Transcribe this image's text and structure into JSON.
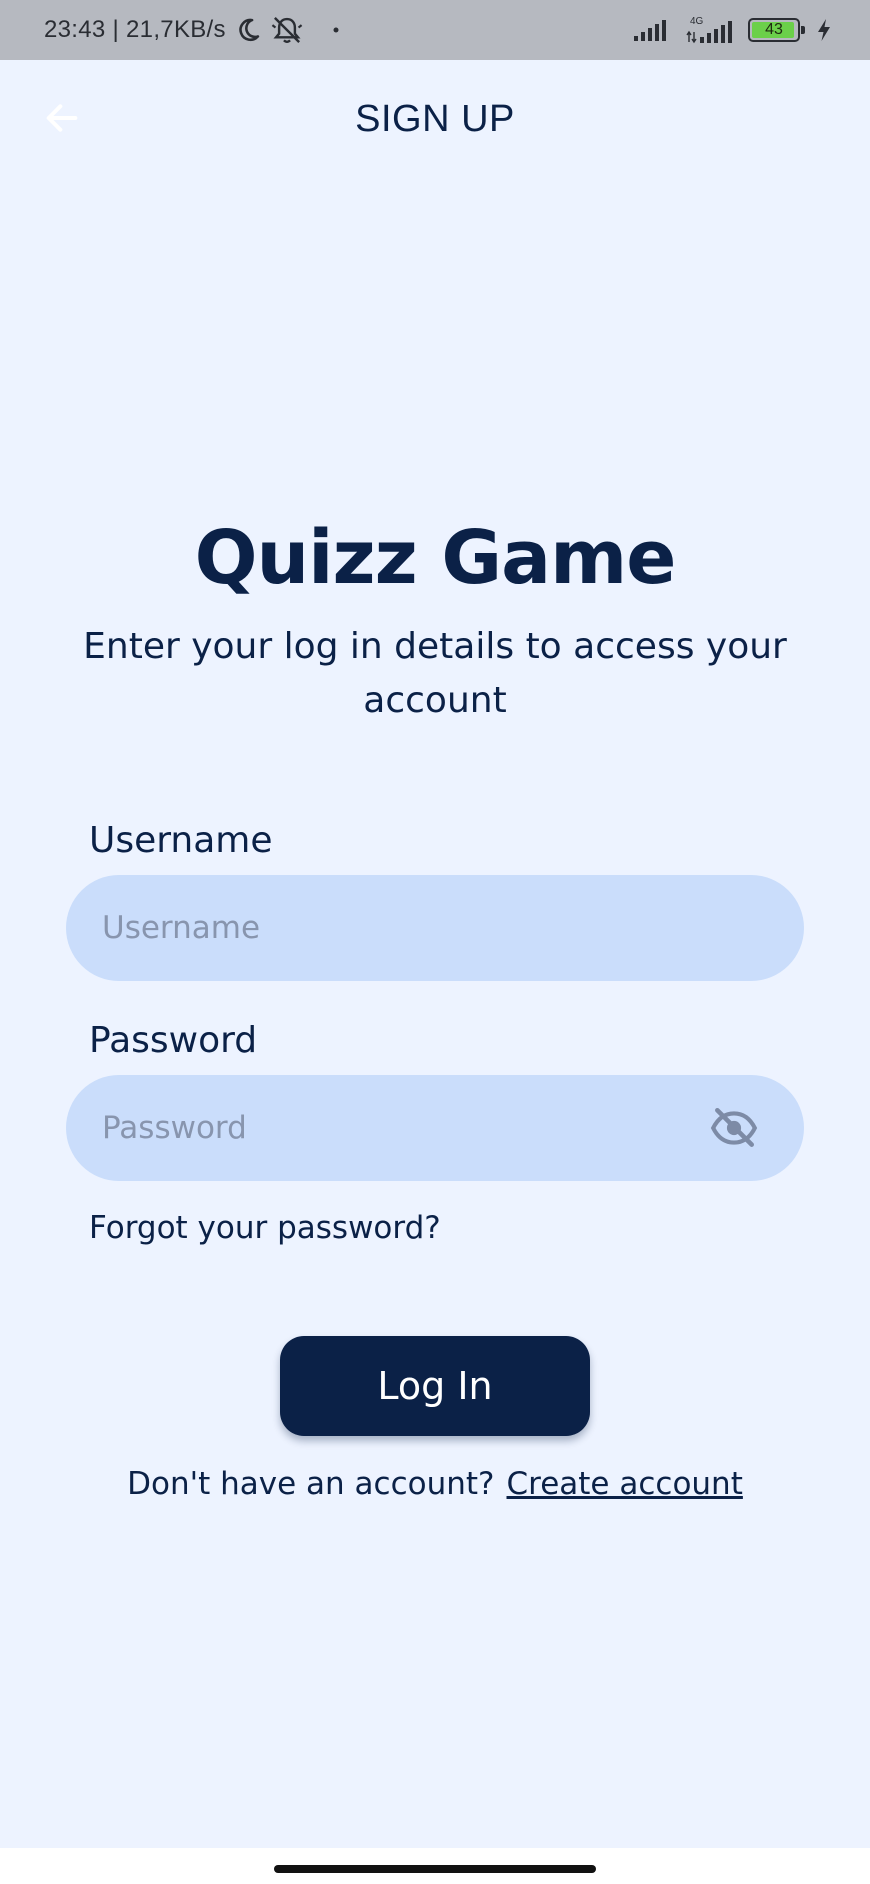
{
  "status_bar": {
    "time_speed": "23:43 | 21,7KB/s",
    "network_type": "4G",
    "battery_level": "43",
    "icons": [
      "moon-icon",
      "bell-off-icon",
      "dot-icon",
      "signal-icon",
      "signal-4g-icon",
      "battery-icon",
      "charging-icon"
    ]
  },
  "app_bar": {
    "title": "SIGN UP",
    "back_icon": "arrow-left-icon"
  },
  "heading": "Quizz Game",
  "subtitle": "Enter your log in details to access your account",
  "form": {
    "username": {
      "label": "Username",
      "placeholder": "Username",
      "value": ""
    },
    "password": {
      "label": "Password",
      "placeholder": "Password",
      "value": "",
      "toggle_icon": "eye-off-icon"
    },
    "forgot_password": "Forgot your password?",
    "login_button": "Log In",
    "no_account_text": "Don't have an account?",
    "create_account_link": "Create account"
  },
  "colors": {
    "background": "#EDF3FF",
    "primary": "#0B2147",
    "field_bg": "#CADDFB",
    "placeholder": "#8895AE",
    "status_bar_bg": "#B6B9C0",
    "battery_fill": "#6BD04A"
  }
}
